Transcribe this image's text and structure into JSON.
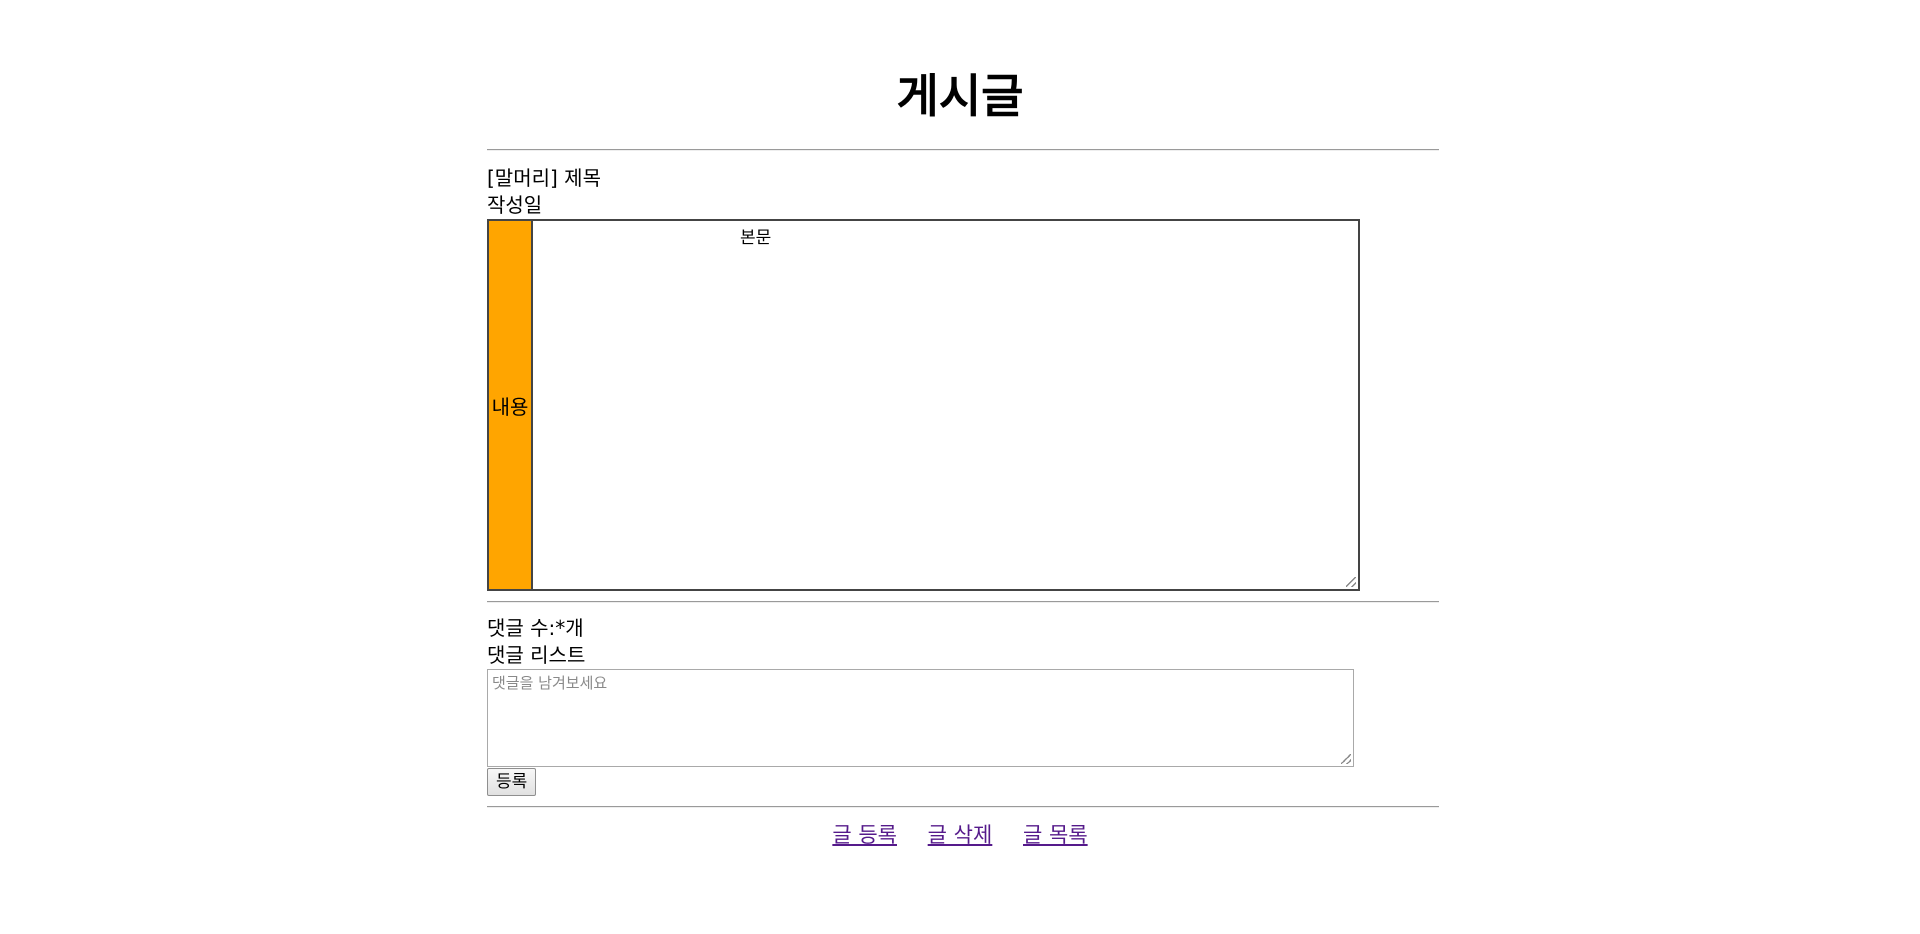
{
  "page": {
    "title": "게시글"
  },
  "post": {
    "header_line": "[말머리] 제목",
    "date_label": "작성일",
    "content_label": "내용",
    "content_text": "본문"
  },
  "comments": {
    "count_label": "댓글 수:*개",
    "list_label": "댓글 리스트",
    "input_placeholder": "댓글을 남겨보세요",
    "submit_label": "등록"
  },
  "footer_links": {
    "register": "글 등록",
    "delete": "글 삭제",
    "list": "글 목록"
  },
  "colors": {
    "label_bg": "#ffa500",
    "visited_link": "#551a8b"
  }
}
